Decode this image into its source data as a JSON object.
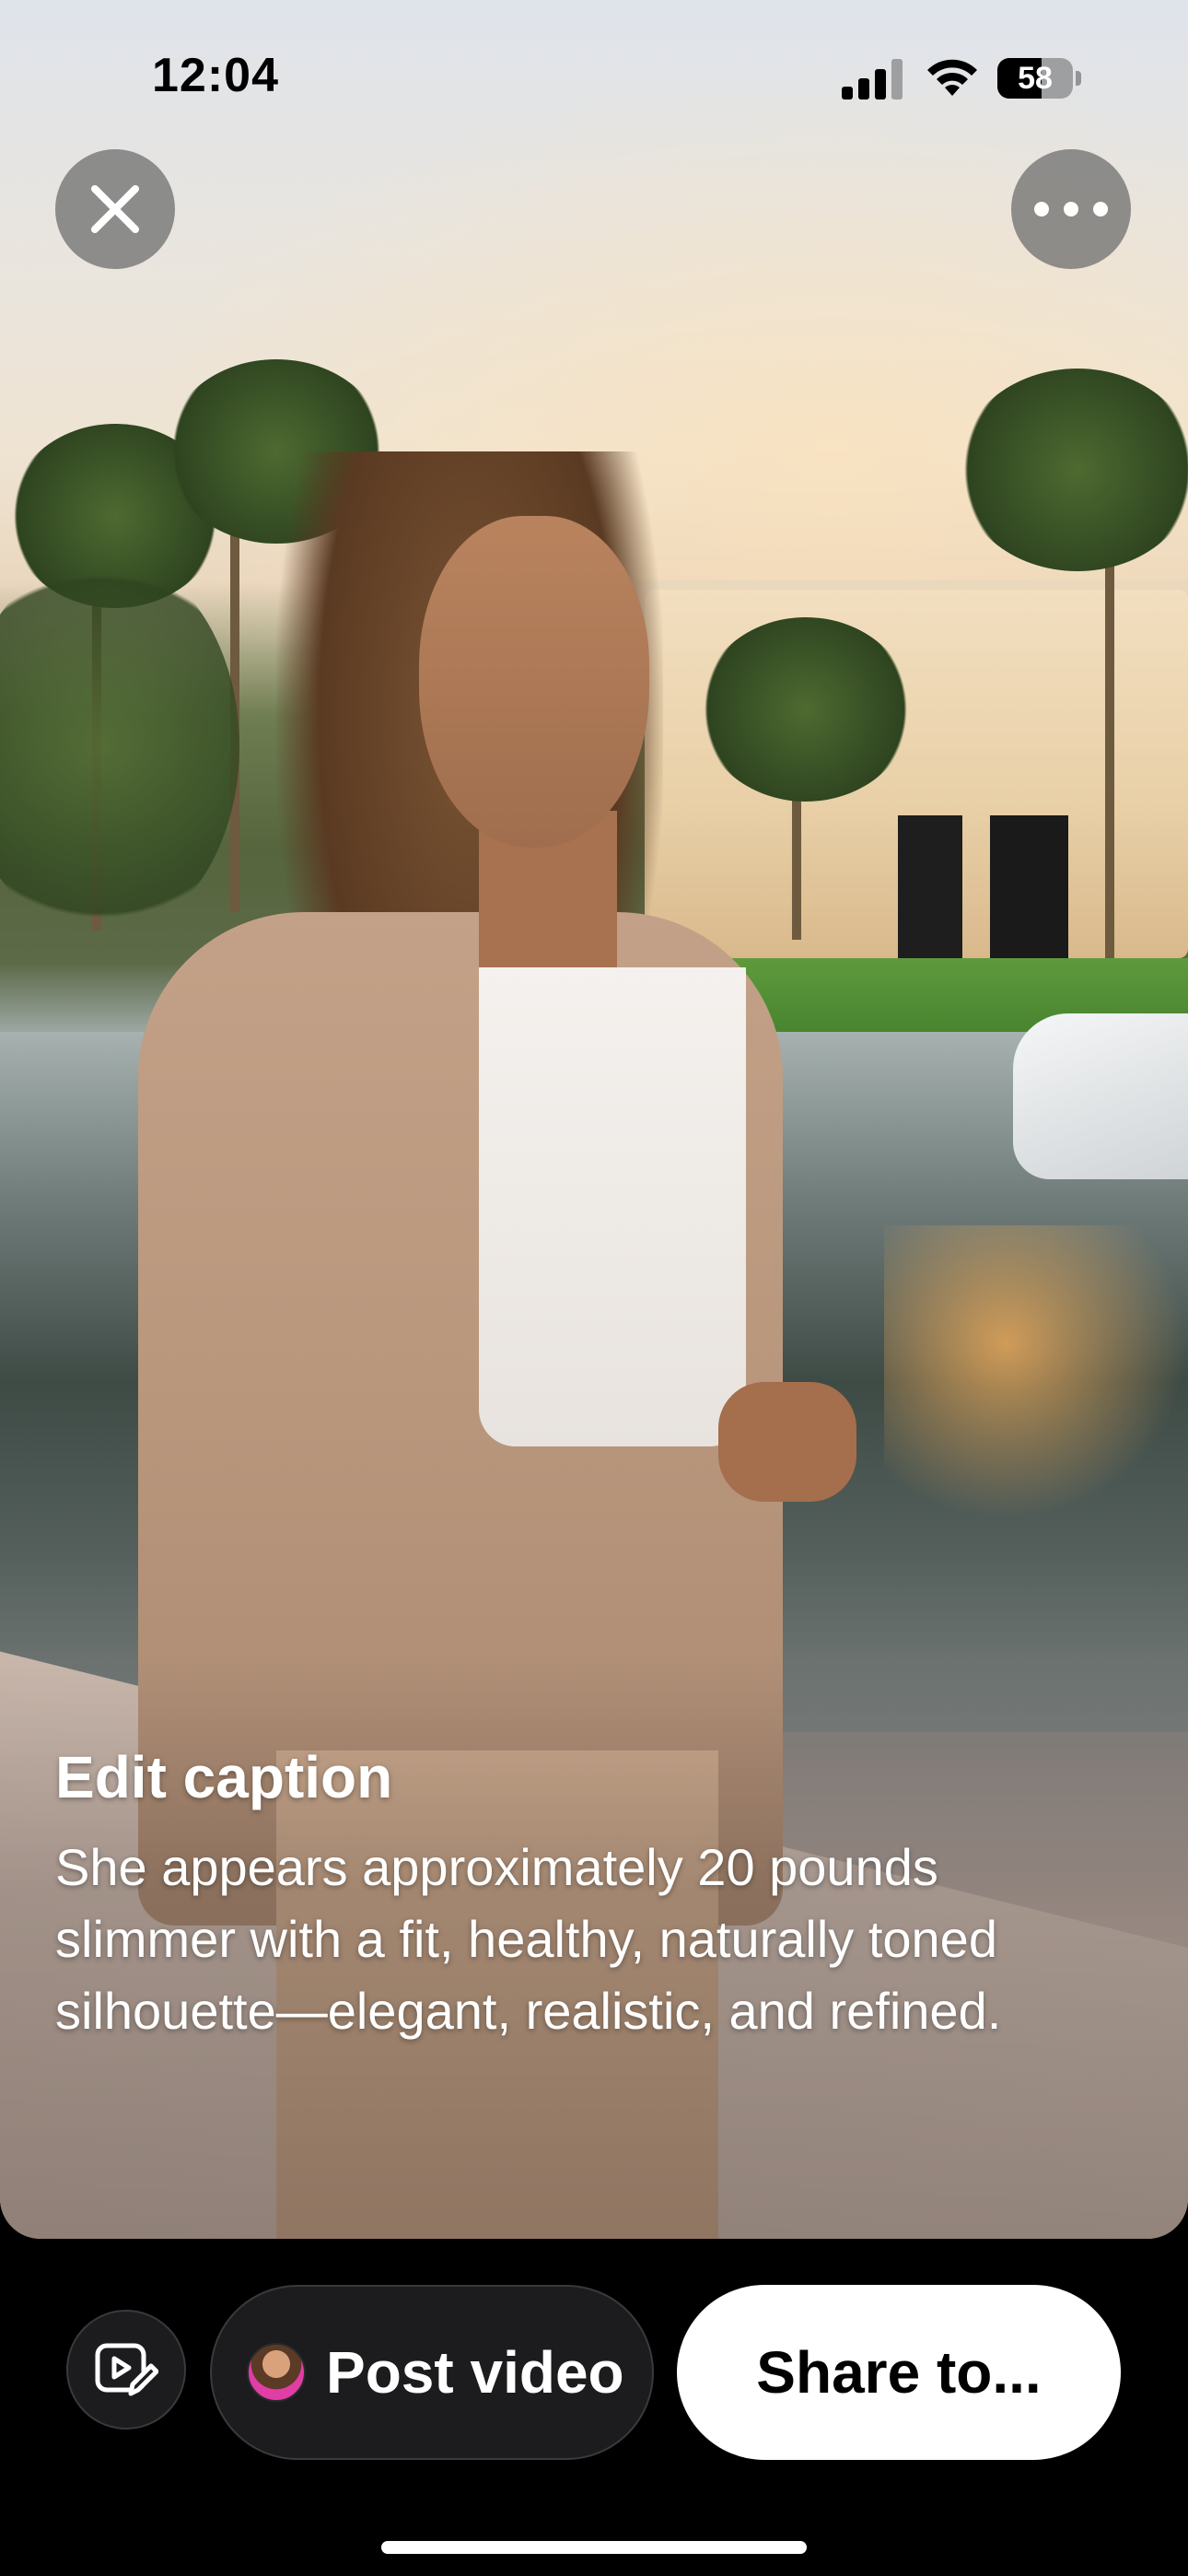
{
  "status_bar": {
    "time": "12:04",
    "battery_level": "58",
    "battery_fraction": 0.58
  },
  "top_controls": {
    "close_icon": "close-icon",
    "more_icon": "more-horizontal-icon"
  },
  "caption": {
    "title": "Edit caption",
    "body": "She appears approximately 20 pounds slimmer with a fit, healthy, naturally toned silhouette—elegant, realistic, and refined."
  },
  "bottom_bar": {
    "edit_icon": "video-edit-icon",
    "post_label": "Post video",
    "share_label": "Share to..."
  },
  "colors": {
    "primary_button_bg": "#ffffff",
    "secondary_button_bg": "#1c1c1e",
    "text_light": "#ffffff"
  }
}
